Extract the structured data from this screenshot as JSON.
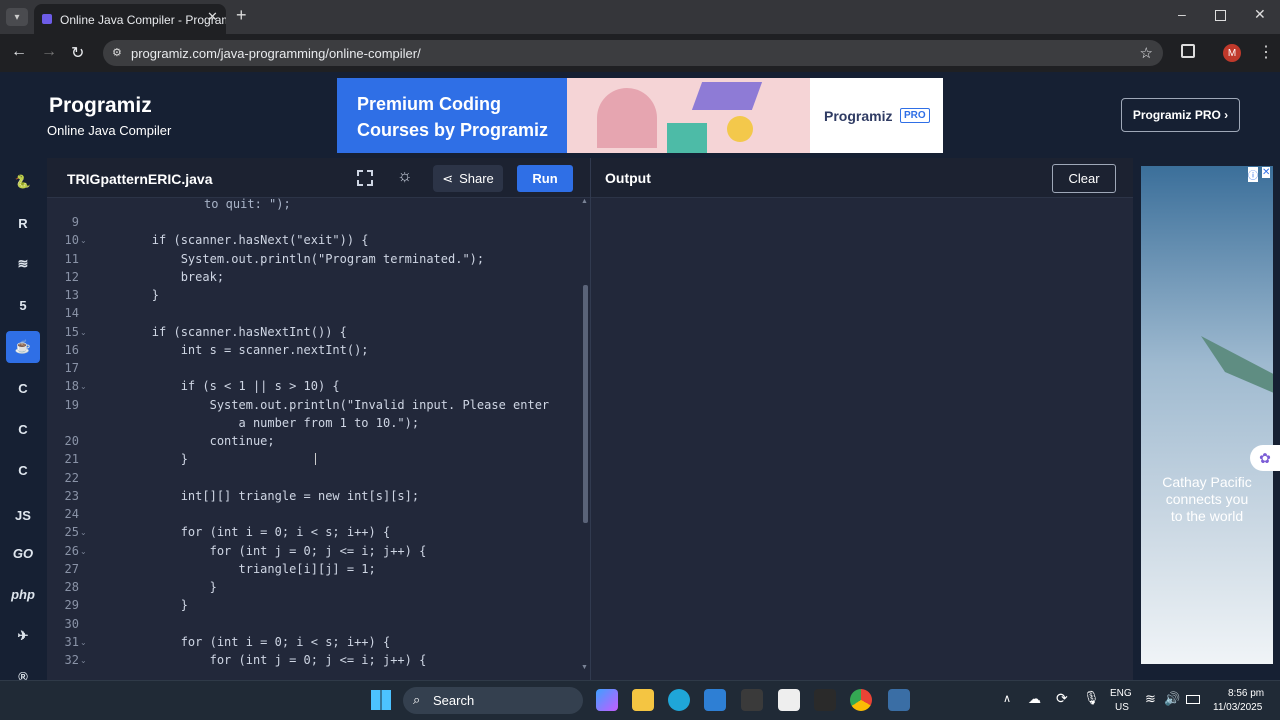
{
  "browser": {
    "tab_title": "Online Java Compiler - Programiz",
    "url": "programiz.com/java-programming/online-compiler/",
    "profile_initial": "M"
  },
  "header": {
    "logo_text": "Programiz",
    "subtitle": "Online Java Compiler",
    "pro_button": "Programiz PRO ›"
  },
  "banner": {
    "line1": "Premium Coding",
    "line2": "Courses by Programiz",
    "brand": "Programiz",
    "badge": "PRO"
  },
  "sidebar": {
    "items": [
      "python",
      "r",
      "sql",
      "html",
      "java",
      "c",
      "cpp",
      "csharp",
      "JS",
      "GO",
      "php",
      "swift",
      "rust"
    ]
  },
  "editor": {
    "filename": "TRIGpatternERIC.java",
    "share_label": "Share",
    "run_label": "Run",
    "wrap_line": "to quit: \");",
    "lines": [
      {
        "n": "9",
        "code": ""
      },
      {
        "n": "10",
        "code": "        if (scanner.hasNext(\"exit\")) {",
        "fold": true
      },
      {
        "n": "11",
        "code": "            System.out.println(\"Program terminated.\");"
      },
      {
        "n": "12",
        "code": "            break;"
      },
      {
        "n": "13",
        "code": "        }"
      },
      {
        "n": "14",
        "code": ""
      },
      {
        "n": "15",
        "code": "        if (scanner.hasNextInt()) {",
        "fold": true
      },
      {
        "n": "16",
        "code": "            int s = scanner.nextInt();"
      },
      {
        "n": "17",
        "code": ""
      },
      {
        "n": "18",
        "code": "            if (s < 1 || s > 10) {",
        "fold": true
      },
      {
        "n": "19",
        "code": "                System.out.println(\"Invalid input. Please enter"
      },
      {
        "n": "",
        "code": "                    a number from 1 to 10.\");"
      },
      {
        "n": "20",
        "code": "                continue;"
      },
      {
        "n": "21",
        "code": "            }"
      },
      {
        "n": "22",
        "code": ""
      },
      {
        "n": "23",
        "code": "            int[][] triangle = new int[s][s];"
      },
      {
        "n": "24",
        "code": ""
      },
      {
        "n": "25",
        "code": "            for (int i = 0; i < s; i++) {",
        "fold": true
      },
      {
        "n": "26",
        "code": "                for (int j = 0; j <= i; j++) {",
        "fold": true
      },
      {
        "n": "27",
        "code": "                    triangle[i][j] = 1;"
      },
      {
        "n": "28",
        "code": "                }"
      },
      {
        "n": "29",
        "code": "            }"
      },
      {
        "n": "30",
        "code": ""
      },
      {
        "n": "31",
        "code": "            for (int i = 0; i < s; i++) {",
        "fold": true
      },
      {
        "n": "32",
        "code": "                for (int j = 0; j <= i; j++) {",
        "fold": true
      }
    ]
  },
  "output": {
    "title": "Output",
    "clear_label": "Clear"
  },
  "ad": {
    "text_line1": "Cathay Pacific",
    "text_line2": "connects you",
    "text_line3": "to the world"
  },
  "taskbar": {
    "search_placeholder": "Search",
    "lang1": "ENG",
    "lang2": "US",
    "time": "8:56 pm",
    "date": "11/03/2025"
  }
}
